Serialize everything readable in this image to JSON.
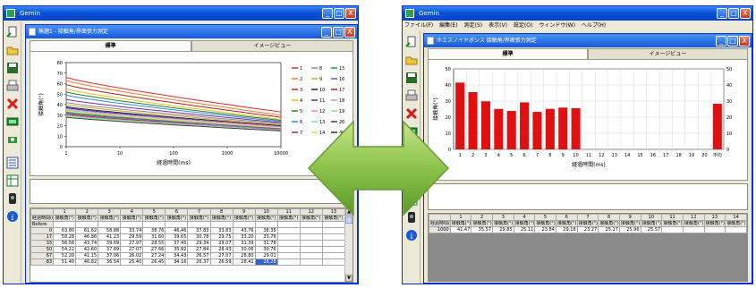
{
  "left": {
    "app_title": "Gemin",
    "window_buttons": [
      "_",
      "□",
      "X"
    ],
    "child_title": "無題1 - 接触角/界面張力測定",
    "tabs": [
      "標準",
      "イメージビュー"
    ],
    "chart": {
      "ylabel": "接触角(°)",
      "xlabel": "経過時間(ms)",
      "yticks": [
        "0",
        "10",
        "20",
        "30",
        "40",
        "50",
        "60",
        "70",
        "80"
      ],
      "xticks": [
        "1",
        "10",
        "100",
        "1000",
        "10000"
      ],
      "legend": [
        {
          "label": "1",
          "color": "#e6262e"
        },
        {
          "label": "2",
          "color": "#f77a2e"
        },
        {
          "label": "3",
          "color": "#c81a1a"
        },
        {
          "label": "4",
          "color": "#d8c61a"
        },
        {
          "label": "5",
          "color": "#2e7a2e"
        },
        {
          "label": "6",
          "color": "#2a90d8"
        },
        {
          "label": "7",
          "color": "#7a2aa8"
        },
        {
          "label": "8",
          "color": "#8c8c8c"
        },
        {
          "label": "9",
          "color": "#c9a53a"
        },
        {
          "label": "10",
          "color": "#202020"
        },
        {
          "label": "11",
          "color": "#2a3aa8"
        },
        {
          "label": "12",
          "color": "#ee7ad0"
        },
        {
          "label": "13",
          "color": "#7fd0e8"
        },
        {
          "label": "14",
          "color": "#f5d23a"
        },
        {
          "label": "15",
          "color": "#1aa83a"
        },
        {
          "label": "16",
          "color": "#5a5ad8"
        },
        {
          "label": "17",
          "color": "#b01a1a"
        },
        {
          "label": "18",
          "color": "#a2a2a2"
        },
        {
          "label": "19",
          "color": "#8ce08c"
        },
        {
          "label": "20",
          "color": "#404040"
        },
        {
          "label": "平均",
          "color": "#1a3a1a"
        }
      ]
    },
    "grid": {
      "col_headers": [
        "",
        "1",
        "2",
        "3",
        "4",
        "5",
        "6",
        "7",
        "8",
        "9",
        "10",
        "11",
        "12",
        "13"
      ],
      "sub_header": "接触角(°)",
      "row_header_label": "経過時間(ms)",
      "before_label": "Before",
      "rows": [
        {
          "time": "0",
          "values": [
            "63.80",
            "61.62",
            "58.88",
            "33.74",
            "38.76",
            "46.46",
            "37.83",
            "33.83",
            "43.76",
            "38.35"
          ]
        },
        {
          "time": "17",
          "values": [
            "58.28",
            "46.86",
            "41.23",
            "29.59",
            "31.60",
            "39.65",
            "30.78",
            "29.75",
            "33.20",
            "33.76"
          ]
        },
        {
          "time": "33",
          "values": [
            "56.56",
            "43.74",
            "39.69",
            "27.97",
            "28.55",
            "37.45",
            "29.34",
            "29.07",
            "31.39",
            "31.78"
          ]
        },
        {
          "time": "50",
          "values": [
            "54.22",
            "42.60",
            "37.69",
            "27.07",
            "27.66",
            "35.92",
            "27.84",
            "28.43",
            "30.06",
            "30.76"
          ]
        },
        {
          "time": "67",
          "values": [
            "52.20",
            "41.15",
            "37.06",
            "26.02",
            "27.24",
            "34.43",
            "26.57",
            "27.07",
            "28.80",
            "29.01"
          ]
        },
        {
          "time": "83",
          "values": [
            "51.40",
            "40.82",
            "36.54",
            "25.40",
            "26.45",
            "34.16",
            "26.37",
            "26.59",
            "28.41",
            "28.28"
          ]
        }
      ]
    }
  },
  "right": {
    "app_title": "Gemin",
    "menu": [
      "ファイル(F)",
      "編集(E)",
      "測定(S)",
      "表示(V)",
      "設定(O)",
      "ウィンドウ(W)",
      "ヘルプ(H)"
    ],
    "child_title": "ホエスノイドボンス 接触角/界面張力測定",
    "tabs": [
      "標準",
      "イメージビュー"
    ],
    "chart": {
      "type": "bar",
      "categories": [
        "1",
        "2",
        "3",
        "4",
        "5",
        "6",
        "7",
        "8",
        "9",
        "10",
        "11",
        "12",
        "13",
        "14",
        "15",
        "16",
        "17",
        "18",
        "19",
        "20",
        "平均"
      ],
      "values": [
        41.47,
        35.57,
        29.85,
        25.11,
        23.84,
        29.18,
        23.27,
        25.17,
        25.96,
        25.57,
        null,
        null,
        null,
        null,
        null,
        null,
        null,
        null,
        null,
        null,
        28.3
      ],
      "bar_color": "#e01010",
      "ylabel": "接触角(°)",
      "xlabel": "経過時間(ms)",
      "ylim": [
        0,
        50
      ],
      "yticks": [
        "0",
        "10",
        "20",
        "30",
        "40",
        "50"
      ]
    },
    "grid": {
      "col_headers": [
        "",
        "1",
        "2",
        "3",
        "4",
        "5",
        "6",
        "7",
        "8",
        "9",
        "10",
        "11",
        "12",
        "13",
        "14"
      ],
      "sub_header": "接触角(°)",
      "row_header_label": "経過時間(ms)",
      "rows": [
        {
          "time": "1000",
          "values": [
            "41.47",
            "35.57",
            "29.85",
            "25.11",
            "23.84",
            "29.18",
            "23.27",
            "25.17",
            "25.96",
            "25.57"
          ]
        }
      ]
    }
  },
  "arrow_color": "#8bc34a"
}
